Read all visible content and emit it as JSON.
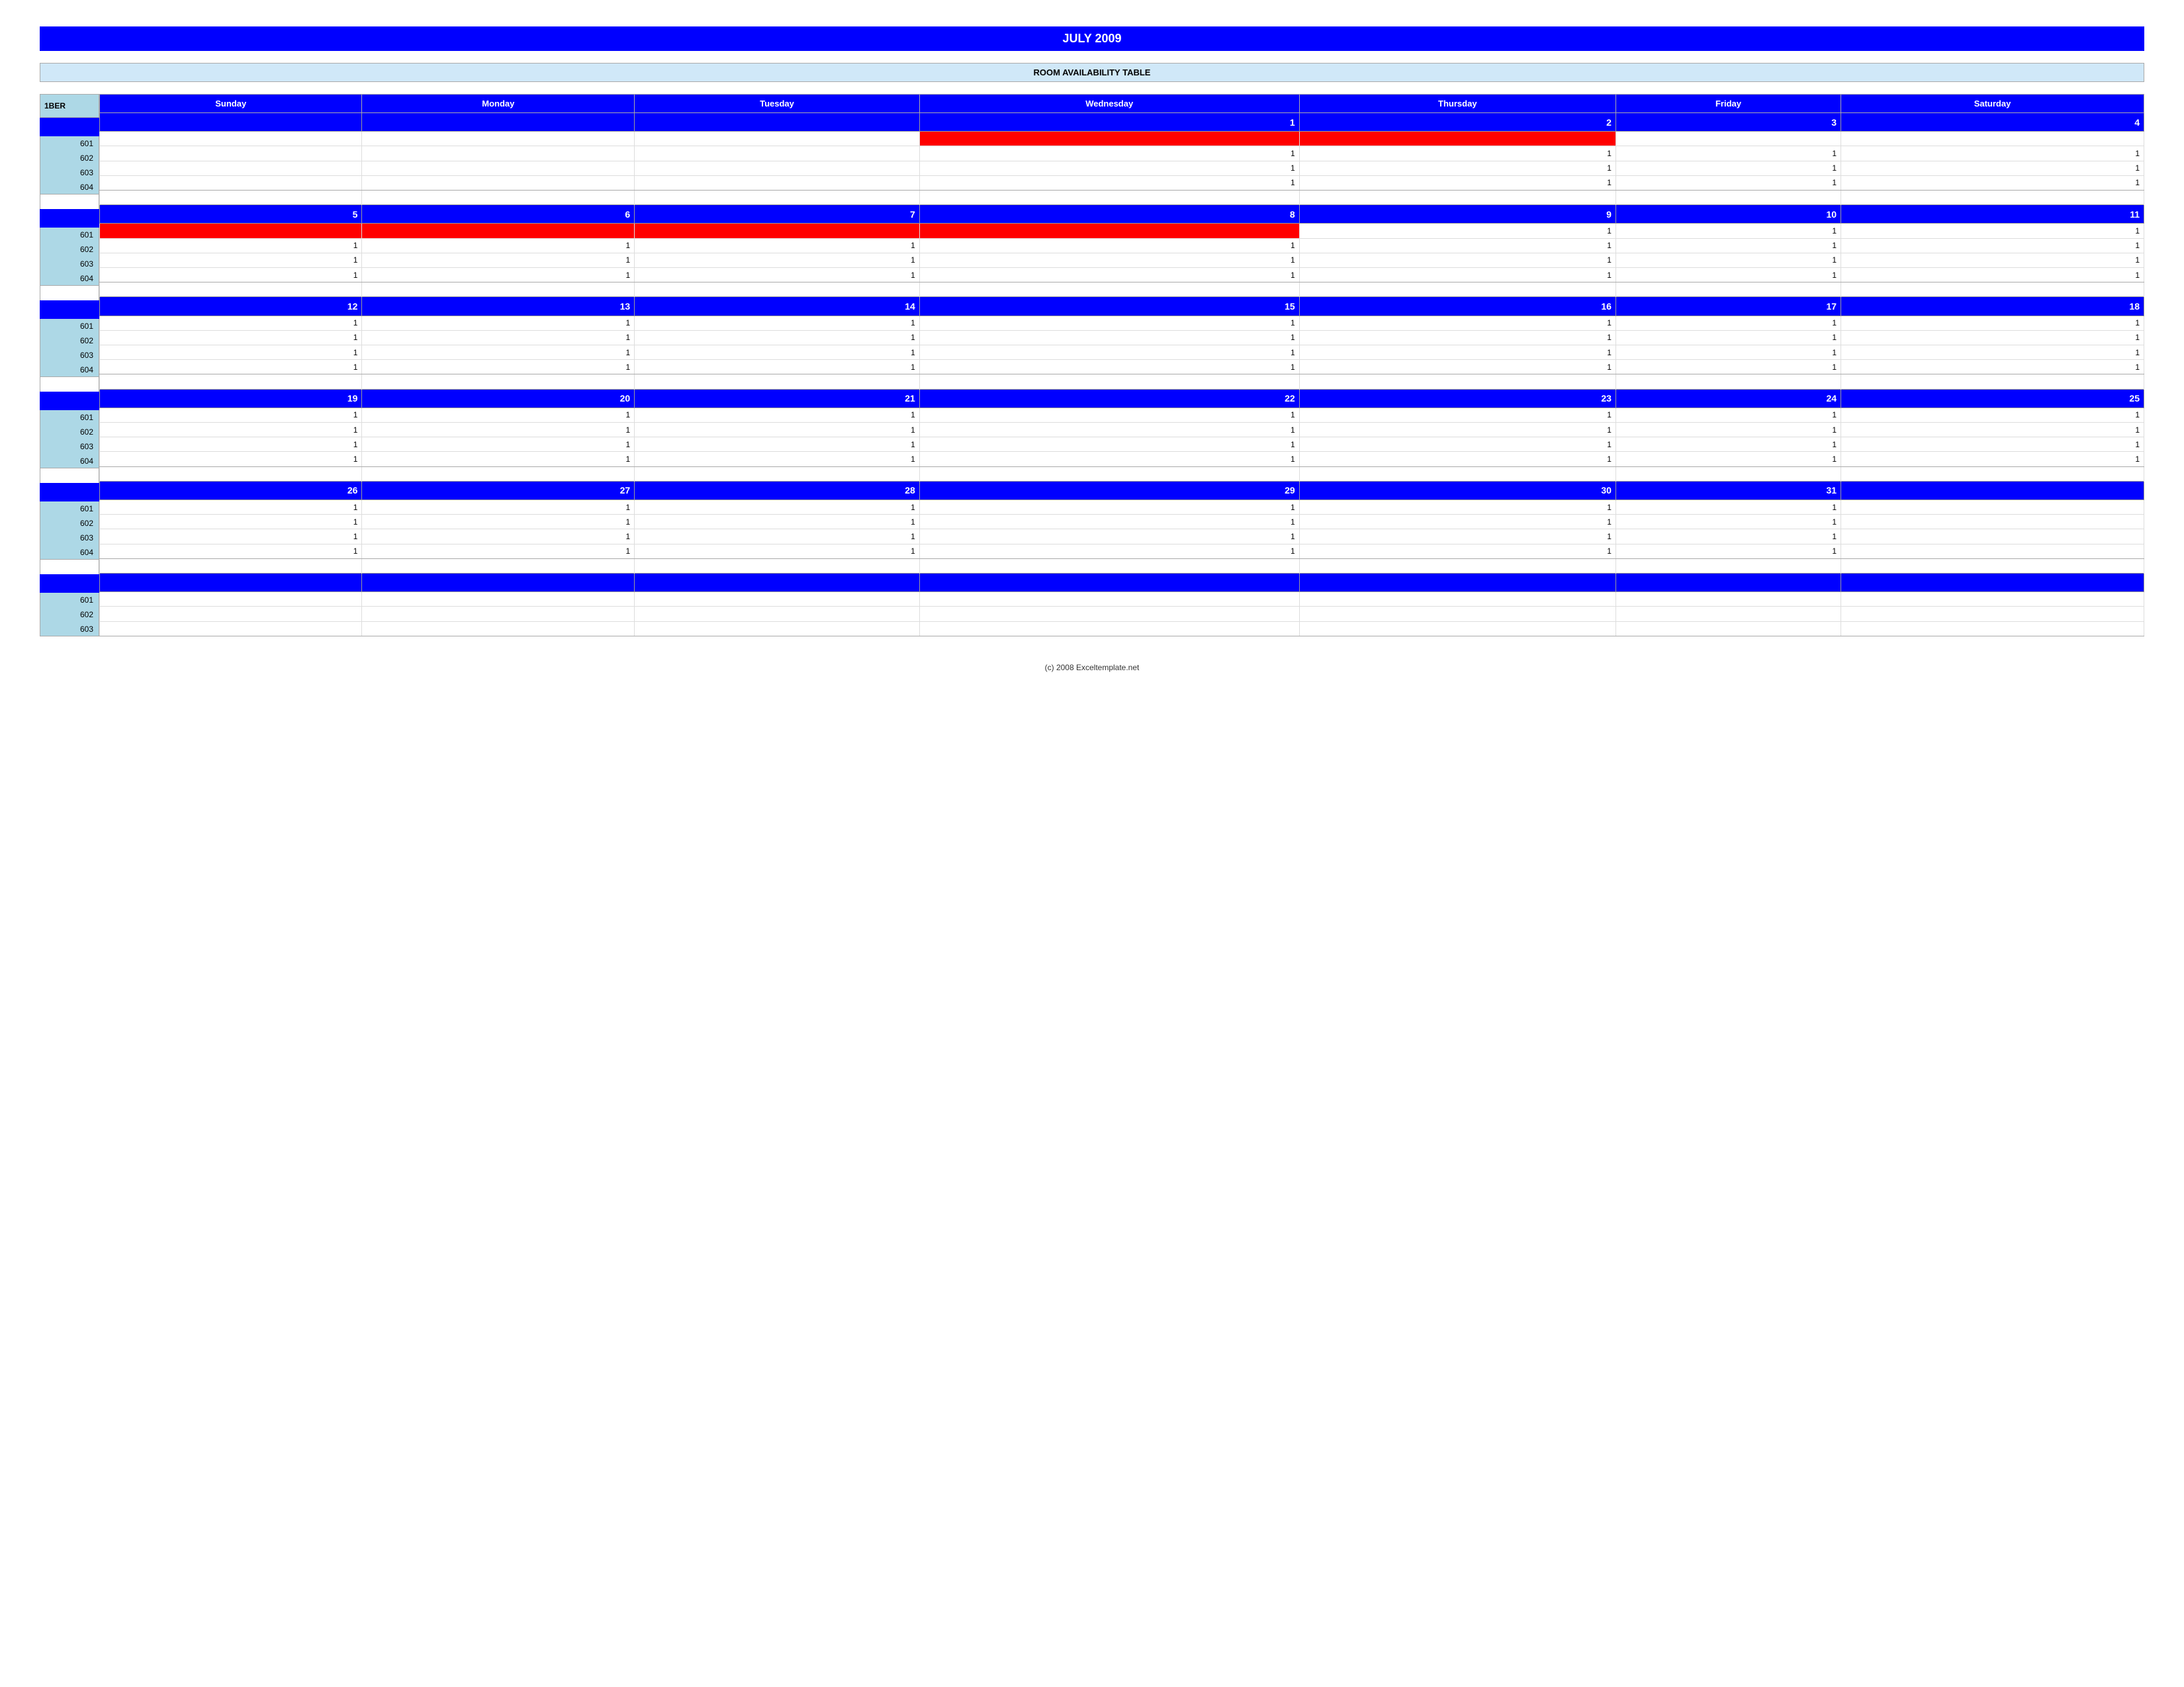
{
  "title": "JULY 2009",
  "subtitle": "ROOM AVAILABILITY TABLE",
  "header_label": "1BER",
  "days": [
    "Sunday",
    "Monday",
    "Tuesday",
    "Wednesday",
    "Thursday",
    "Friday",
    "Saturday"
  ],
  "weeks": [
    {
      "dates": [
        "",
        "",
        "",
        "1",
        "2",
        "3",
        "4"
      ],
      "rooms": [
        {
          "id": "601",
          "values": [
            "",
            "",
            "",
            "red",
            "red",
            "",
            ""
          ]
        },
        {
          "id": "602",
          "values": [
            "",
            "",
            "",
            "1",
            "1",
            "1",
            "1"
          ]
        },
        {
          "id": "603",
          "values": [
            "",
            "",
            "",
            "1",
            "1",
            "1",
            "1"
          ]
        },
        {
          "id": "604",
          "values": [
            "",
            "",
            "",
            "1",
            "1",
            "1",
            "1"
          ]
        }
      ]
    },
    {
      "dates": [
        "5",
        "6",
        "7",
        "8",
        "9",
        "10",
        "11"
      ],
      "rooms": [
        {
          "id": "601",
          "values": [
            "red",
            "red",
            "red",
            "red",
            "1",
            "1",
            "1"
          ]
        },
        {
          "id": "602",
          "values": [
            "1",
            "1",
            "1",
            "1",
            "1",
            "1",
            "1"
          ]
        },
        {
          "id": "603",
          "values": [
            "1",
            "1",
            "1",
            "1",
            "1",
            "1",
            "1"
          ]
        },
        {
          "id": "604",
          "values": [
            "1",
            "1",
            "1",
            "1",
            "1",
            "1",
            "1"
          ]
        }
      ]
    },
    {
      "dates": [
        "12",
        "13",
        "14",
        "15",
        "16",
        "17",
        "18"
      ],
      "rooms": [
        {
          "id": "601",
          "values": [
            "1",
            "1",
            "1",
            "1",
            "1",
            "1",
            "1"
          ]
        },
        {
          "id": "602",
          "values": [
            "1",
            "1",
            "1",
            "1",
            "1",
            "1",
            "1"
          ]
        },
        {
          "id": "603",
          "values": [
            "1",
            "1",
            "1",
            "1",
            "1",
            "1",
            "1"
          ]
        },
        {
          "id": "604",
          "values": [
            "1",
            "1",
            "1",
            "1",
            "1",
            "1",
            "1"
          ]
        }
      ]
    },
    {
      "dates": [
        "19",
        "20",
        "21",
        "22",
        "23",
        "24",
        "25"
      ],
      "rooms": [
        {
          "id": "601",
          "values": [
            "1",
            "1",
            "1",
            "1",
            "1",
            "1",
            "1"
          ]
        },
        {
          "id": "602",
          "values": [
            "1",
            "1",
            "1",
            "1",
            "1",
            "1",
            "1"
          ]
        },
        {
          "id": "603",
          "values": [
            "1",
            "1",
            "1",
            "1",
            "1",
            "1",
            "1"
          ]
        },
        {
          "id": "604",
          "values": [
            "1",
            "1",
            "1",
            "1",
            "1",
            "1",
            "1"
          ]
        }
      ]
    },
    {
      "dates": [
        "26",
        "27",
        "28",
        "29",
        "30",
        "31",
        ""
      ],
      "rooms": [
        {
          "id": "601",
          "values": [
            "1",
            "1",
            "1",
            "1",
            "1",
            "1",
            ""
          ]
        },
        {
          "id": "602",
          "values": [
            "1",
            "1",
            "1",
            "1",
            "1",
            "1",
            ""
          ]
        },
        {
          "id": "603",
          "values": [
            "1",
            "1",
            "1",
            "1",
            "1",
            "1",
            ""
          ]
        },
        {
          "id": "604",
          "values": [
            "1",
            "1",
            "1",
            "1",
            "1",
            "1",
            ""
          ]
        }
      ]
    },
    {
      "dates": [
        "",
        "",
        "",
        "",
        "",
        "",
        ""
      ],
      "rooms": [
        {
          "id": "601",
          "values": [
            "",
            "",
            "",
            "",
            "",
            "",
            ""
          ]
        },
        {
          "id": "602",
          "values": [
            "",
            "",
            "",
            "",
            "",
            "",
            ""
          ]
        },
        {
          "id": "603",
          "values": [
            "",
            "",
            "",
            "",
            "",
            "",
            ""
          ]
        }
      ]
    }
  ],
  "footer": "(c) 2008 Exceltemplate.net"
}
